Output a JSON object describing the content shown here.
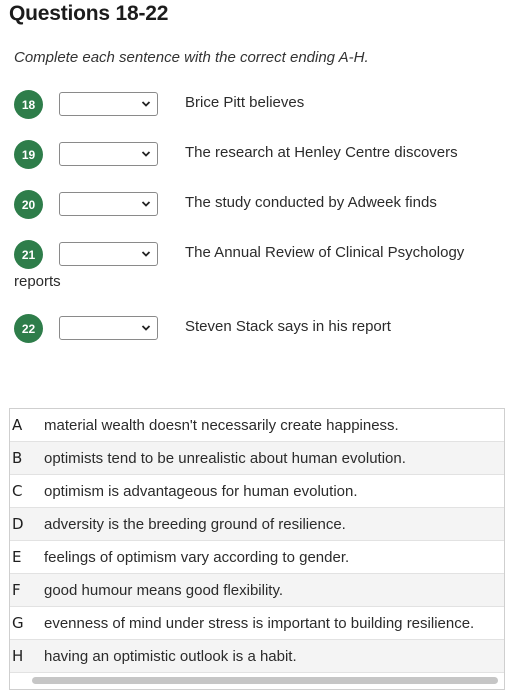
{
  "title": "Questions 18-22",
  "instructions": "Complete each sentence with the correct ending A-H.",
  "questions": [
    {
      "number": "18",
      "text": "Brice Pitt believes",
      "selected": ""
    },
    {
      "number": "19",
      "text": "The research at Henley Centre discovers",
      "selected": ""
    },
    {
      "number": "20",
      "text": "The study conducted by Adweek finds",
      "selected": ""
    },
    {
      "number": "21",
      "text": "The Annual Review of Clinical Psychology",
      "continuation": "reports",
      "selected": ""
    },
    {
      "number": "22",
      "text": "Steven Stack says in his report",
      "selected": ""
    }
  ],
  "options": [
    {
      "letter": "A",
      "text": "material wealth doesn't necessarily create happiness."
    },
    {
      "letter": "B",
      "text": "optimists tend to be unrealistic about human evolution."
    },
    {
      "letter": "C",
      "text": "optimism is advantageous for human evolution."
    },
    {
      "letter": "D",
      "text": "adversity is the breeding ground of resilience."
    },
    {
      "letter": "E",
      "text": "feelings of optimism vary according to gender."
    },
    {
      "letter": "F",
      "text": "good humour means good flexibility."
    },
    {
      "letter": "G",
      "text": "evenness of mind under stress is important to building resilience."
    },
    {
      "letter": "H",
      "text": "having an optimistic outlook is a habit."
    }
  ],
  "icons": {
    "dropdown": "chevron-down-icon"
  },
  "colors": {
    "question_badge": "#2e7d4a"
  }
}
